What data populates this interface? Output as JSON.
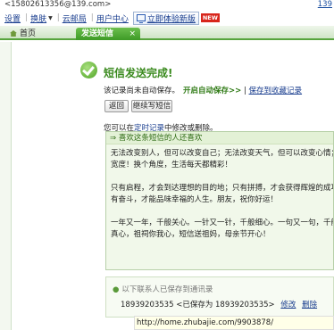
{
  "topbar": {
    "email": "<15802613356@139.com>",
    "right_fragment": "139"
  },
  "nav": {
    "settings": "设置",
    "skin": "换肤",
    "cloud_mail": "云邮局",
    "user_center": "用户中心",
    "install_label": "立即体验新版",
    "new_badge": "NEW"
  },
  "tabs": [
    {
      "label": "首页"
    },
    {
      "label": "发送短信",
      "close": "×"
    }
  ],
  "result": {
    "title": "短信发送完成!",
    "not_saved": "该记录尚未自动保存。",
    "auto_save": "开启自动保存>>",
    "sep": "|",
    "save_link": "保存到收藏记录",
    "back_btn": "返回",
    "continue_btn": "继续写短信",
    "edit_prefix": "您可以在",
    "edit_link": "定时记录",
    "edit_suffix": "中修改或删除。"
  },
  "sms": {
    "heading": "⇒ 喜欢这条短信的人还喜欢",
    "paragraphs": [
      [
        "无法改变别人，但可以改变自己；无法改变天气，但可以改变心情；无法改",
        "宽度！换个角度，生活每天都精彩！"
      ],
      [
        "只有启程，才会到达理想的目的地；只有拼搏，才会获得辉煌的成功；只有",
        "有奋斗，才能品味幸福的人生。朋友，祝你好运！"
      ],
      [
        "一年又一年，千般关心。一针又一针，千般细心。一句又一句，千般耐心。",
        "真心，祖祠你我心，短信送祖妈，母亲节开心！"
      ]
    ]
  },
  "contact": {
    "heading": "以下联系人已保存到通讯录",
    "number": "18939203535",
    "saved_as": "<已保存为 18939203535>",
    "edit": "修改",
    "delete": "删除"
  },
  "status": {
    "url": "http://home.zhubajie.com/9903878/"
  }
}
